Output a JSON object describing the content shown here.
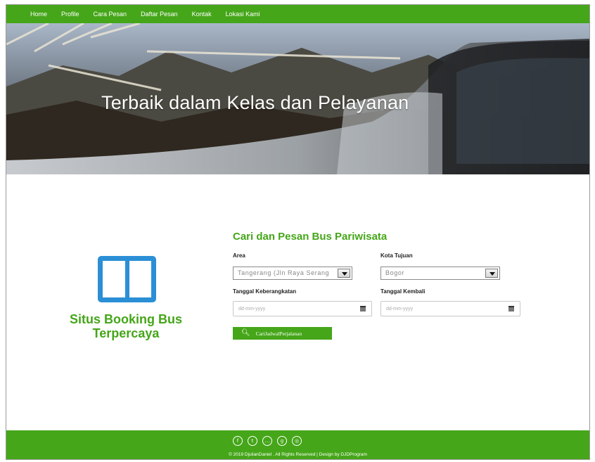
{
  "nav": {
    "items": [
      "Home",
      "Profile",
      "Cara Pesan",
      "Daftar Pesan",
      "Kontak",
      "Lokasi Kami"
    ]
  },
  "hero": {
    "title": "Terbaik dalam Kelas dan Pelayanan"
  },
  "brand": {
    "icon": "columns-icon",
    "line1": "Situs Booking Bus",
    "line2": "Terpercaya",
    "icon_color": "#2b8fd6"
  },
  "form": {
    "title": "Cari dan Pesan Bus Pariwisata",
    "area_label": "Area",
    "area_value": "Tangerang (Jln Raya Serang",
    "tujuan_label": "Kota Tujuan",
    "tujuan_value": "Bogor",
    "berangkat_label": "Tanggal Keberangkatan",
    "berangkat_placeholder": "dd-mm-yyyy",
    "kembali_label": "Tanggal Kembali",
    "kembali_placeholder": "dd-mm-yyyy",
    "search_button": "CariJadwalPerjalanan",
    "search_icon": "search-icon"
  },
  "footer": {
    "social_icons": [
      "facebook-icon",
      "twitter-icon",
      "chat-icon",
      "google-plus-icon",
      "instagram-icon"
    ],
    "copyright": "© 2019 DjulianDaniel . All Rights Reserved | Design by DJDProgram"
  },
  "colors": {
    "accent": "#45a619",
    "brand_blue": "#2b8fd6"
  }
}
